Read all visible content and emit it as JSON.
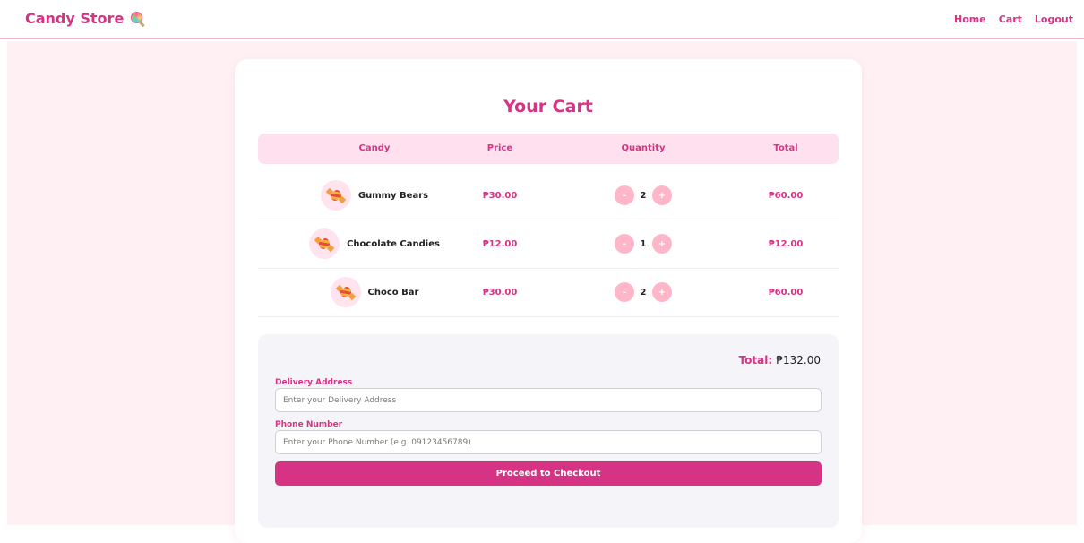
{
  "header": {
    "brand": "Candy Store",
    "brand_icon": "lollipop-icon",
    "nav": [
      "Home",
      "Cart",
      "Logout"
    ],
    "accent_color": "#d63384"
  },
  "cart": {
    "title": "Your Cart",
    "columns": [
      "Candy",
      "Price",
      "Quantity",
      "Total"
    ],
    "items": [
      {
        "name": "Gummy Bears",
        "price": "₱30.00",
        "quantity": "2",
        "total": "₱60.00",
        "icon": "candy-icon"
      },
      {
        "name": "Chocolate Candies",
        "price": "₱12.00",
        "quantity": "1",
        "total": "₱12.00",
        "icon": "candy-icon"
      },
      {
        "name": "Choco Bar",
        "price": "₱30.00",
        "quantity": "2",
        "total": "₱60.00",
        "icon": "candy-icon"
      }
    ],
    "decrement_label": "-",
    "increment_label": "+"
  },
  "summary": {
    "total_label": "Total:",
    "total_value": "₱132.00",
    "address_label": "Delivery Address",
    "address_placeholder": "Enter your Delivery Address",
    "phone_label": "Phone Number",
    "phone_placeholder": "Enter your Phone Number (e.g. 09123456789)",
    "checkout_label": "Proceed to Checkout"
  }
}
